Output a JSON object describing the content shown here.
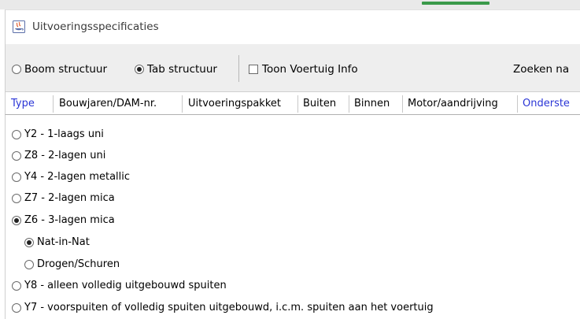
{
  "window": {
    "title": "Uitvoeringsspecificaties"
  },
  "toolbar": {
    "tree_label": "Boom structuur",
    "tab_label": "Tab structuur",
    "vehicle_info_label": "Toon Voertuig Info",
    "search_label": "Zoeken na"
  },
  "tabs": [
    {
      "label": "Type",
      "active": true
    },
    {
      "label": "Bouwjaren/DAM-nr."
    },
    {
      "label": "Uitvoeringspakket"
    },
    {
      "label": "Buiten"
    },
    {
      "label": "Binnen"
    },
    {
      "label": "Motor/aandrijving"
    },
    {
      "label": "Onderste"
    }
  ],
  "options": [
    {
      "label": "Y2 - 1-laags uni",
      "checked": false
    },
    {
      "label": "Z8 - 2-lagen uni",
      "checked": false
    },
    {
      "label": "Y4 - 2-lagen metallic",
      "checked": false
    },
    {
      "label": "Z7 - 2-lagen mica",
      "checked": false
    },
    {
      "label": "Z6 - 3-lagen mica",
      "checked": true
    },
    {
      "label": "Nat-in-Nat",
      "checked": true
    },
    {
      "label": "Drogen/Schuren",
      "checked": false
    },
    {
      "label": "Y8 - alleen volledig uitgebouwd spuiten",
      "checked": false
    },
    {
      "label": "Y7 - voorspuiten of volledig spuiten uitgebouwd, i.c.m. spuiten aan het voertuig",
      "checked": false
    }
  ],
  "colors": {
    "tab_active": "#2a35d6",
    "toolbar_bg": "#eeeeee"
  }
}
